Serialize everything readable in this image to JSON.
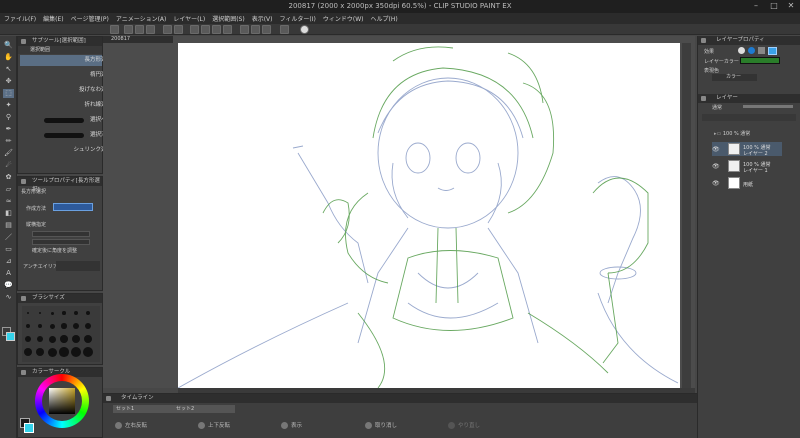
{
  "window": {
    "title": "200817 (2000 x 2000px 350dpi 60.5%)  - CLIP STUDIO PAINT EX",
    "controls": [
      "–",
      "□",
      "✕"
    ]
  },
  "menu": {
    "items": [
      "ファイル(F)",
      "編集(E)",
      "ページ管理(P)",
      "アニメーション(A)",
      "レイヤー(L)",
      "選択範囲(S)",
      "表示(V)",
      "フィルター(I)",
      "ウィンドウ(W)",
      "ヘルプ(H)"
    ]
  },
  "document": {
    "tab_label": "200817"
  },
  "subtool_panel": {
    "header": "サブツール[選択範囲]",
    "category": "選択範囲",
    "items": [
      "長方形選択",
      "楕円選択",
      "投げなわ選択",
      "折れ線選択",
      "選択ペン",
      "選択消し",
      "シュリンク選択"
    ]
  },
  "tool_property": {
    "header": "ツールプロパティ[長方形選択]",
    "name": "長方形選択",
    "row_labels": [
      "作成方法",
      "縦横指定",
      "確定後に角度を調整",
      "アンチエイリアス"
    ]
  },
  "brush_size": {
    "header": "ブラシサイズ"
  },
  "color_wheel": {
    "header": "カラーサークル",
    "main_color": "#34d2ea",
    "sub_color": "#1a1a1a"
  },
  "layer_property": {
    "header": "レイヤープロパティ",
    "effect_label": "効果",
    "layer_color_label": "レイヤーカラー",
    "layer_color": "#2a7d2a",
    "expression_label": "表現色",
    "expression_value": "カラー"
  },
  "layer_panel": {
    "header": "レイヤー",
    "blend_mode": "通常",
    "folder_label": "100 % 通常",
    "layers": [
      {
        "name": "レイヤー 2",
        "opacity": "100 % 通常"
      },
      {
        "name": "レイヤー 1",
        "opacity": "100 % 通常"
      },
      {
        "name": "用紙",
        "opacity": ""
      }
    ]
  },
  "timeline": {
    "header": "タイムライン",
    "tracks": [
      "セット1",
      "セット2"
    ],
    "buttons": [
      "左右反転",
      "上下反転",
      "表示",
      "取り消し",
      "やり直し"
    ]
  }
}
